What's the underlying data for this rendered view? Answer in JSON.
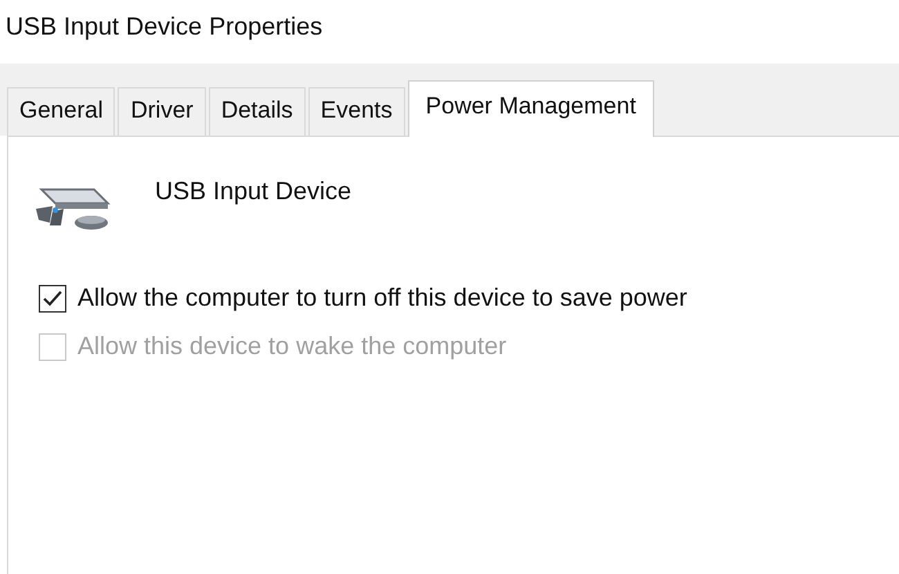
{
  "window": {
    "title": "USB Input Device Properties"
  },
  "tabs": [
    {
      "label": "General",
      "selected": false
    },
    {
      "label": "Driver",
      "selected": false
    },
    {
      "label": "Details",
      "selected": false
    },
    {
      "label": "Events",
      "selected": false
    },
    {
      "label": "Power Management",
      "selected": true
    }
  ],
  "device": {
    "name": "USB Input Device"
  },
  "options": [
    {
      "label": "Allow the computer to turn off this device to save power",
      "checked": true,
      "disabled": false
    },
    {
      "label": "Allow this device to wake the computer",
      "checked": false,
      "disabled": true
    }
  ]
}
